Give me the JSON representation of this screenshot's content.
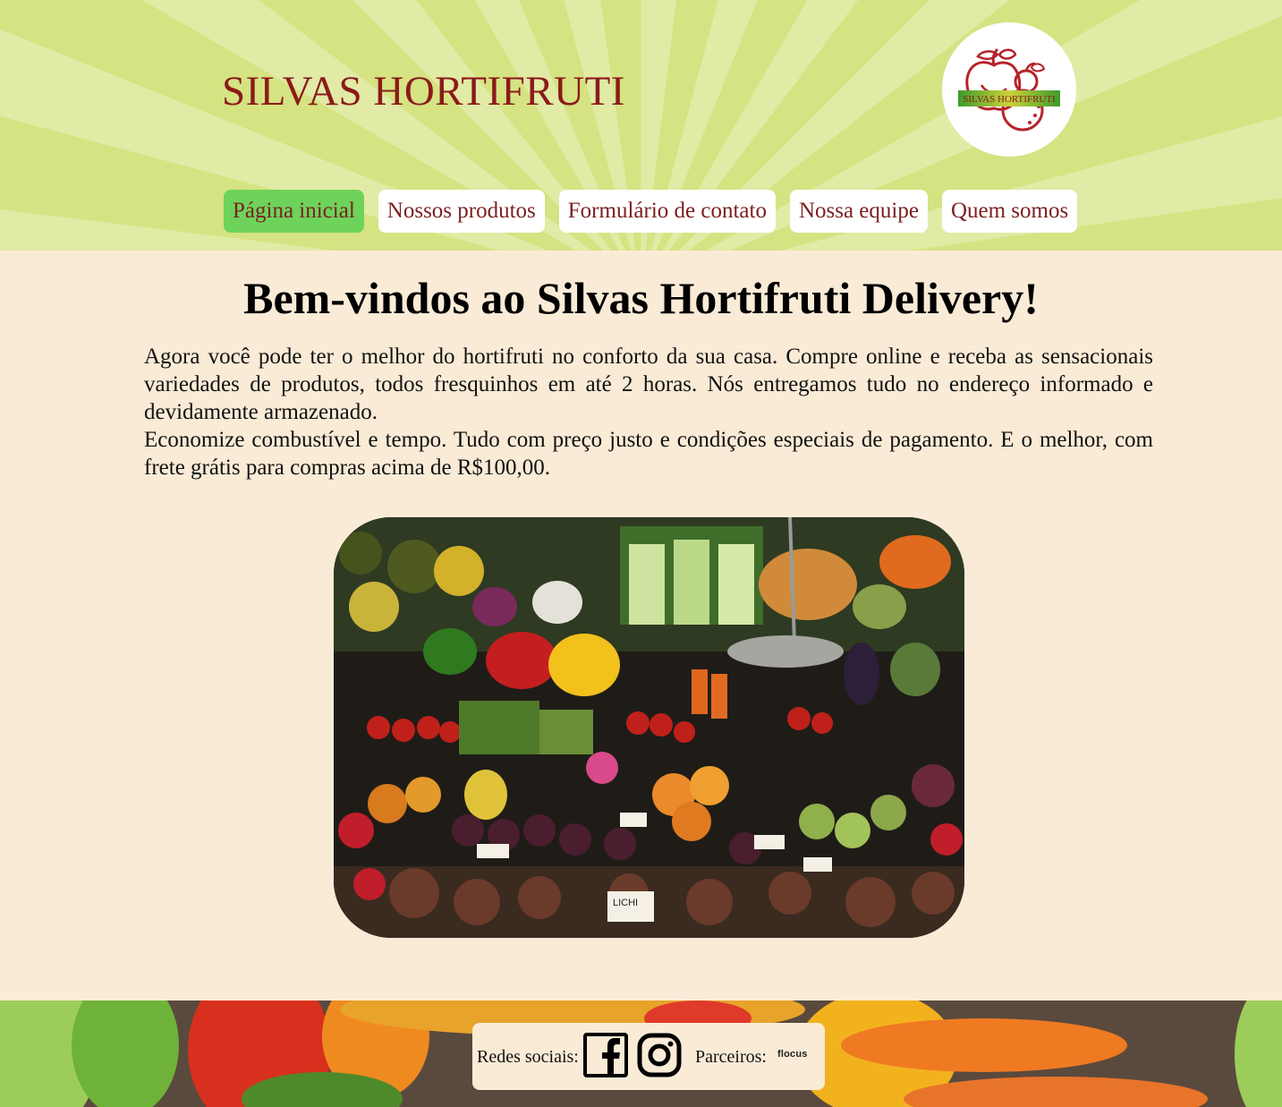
{
  "header": {
    "title": "SILVAS HORTIFRUTI",
    "logo_text": "SILVAS HORTIFRUTI",
    "nav": [
      {
        "label": "Página inicial",
        "active": true
      },
      {
        "label": "Nossos produtos",
        "active": false
      },
      {
        "label": "Formulário de contato",
        "active": false
      },
      {
        "label": "Nossa equipe",
        "active": false
      },
      {
        "label": "Quem somos",
        "active": false
      }
    ]
  },
  "main": {
    "title": "Bem-vindos ao Silvas Hortifruti Delivery!",
    "paragraph1": "Agora você pode ter o melhor do hortifruti no conforto da sua casa. Compre online e receba as sensacionais variedades de produtos, todos fresquinhos em até 2 horas. Nós entregamos tudo no endereço informado e devidamente armazenado.",
    "paragraph2": "Economize combustível e tempo. Tudo com preço justo e condições especiais de pagamento. E o melhor, com frete grátis para compras acima de R$100,00.",
    "image_label": "LICHI"
  },
  "footer": {
    "social_label": "Redes sociais:",
    "social_icons": [
      "facebook-icon",
      "instagram-icon"
    ],
    "partners_label": "Parceiros:",
    "partner_name": "flocus"
  },
  "colors": {
    "header_bg": "#d5e382",
    "title_color": "#8b1a1a",
    "nav_active": "#6dd35a",
    "page_bg": "#faebd7",
    "footer_bg": "#5a4a3d"
  }
}
